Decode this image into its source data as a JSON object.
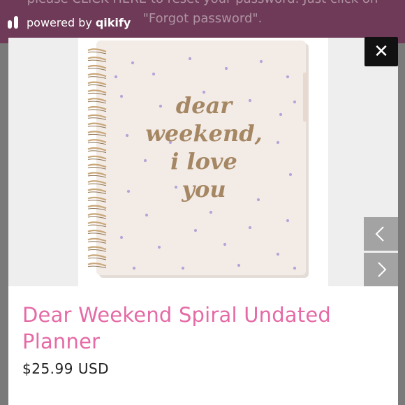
{
  "background_banner": {
    "line1": "please CLICK HERE to reset your password. Just click on",
    "line2": "\"Forgot password\"."
  },
  "powered_by": {
    "prefix": "powered by",
    "brand": "qikify",
    "logo_icon": "qikify-logo-icon"
  },
  "modal": {
    "close_label": "✕",
    "prev_icon": "chevron-left-icon",
    "next_icon": "chevron-right-icon",
    "image_alt": "dear weekend, i love you planner cover",
    "cover_text": [
      "dear",
      "weekend,",
      "i love",
      "you"
    ],
    "product_title": "Dear Weekend Spiral Undated Planner",
    "product_price": "$25.99 USD"
  },
  "colors": {
    "title_pink": "#e56aa5",
    "banner_plum": "#6e3a57",
    "cover_gold": "#a68763",
    "dot_lavender": "#b1a6d8",
    "cover_paper": "#f3ebe6",
    "coil_gold": "#c9a77a"
  }
}
